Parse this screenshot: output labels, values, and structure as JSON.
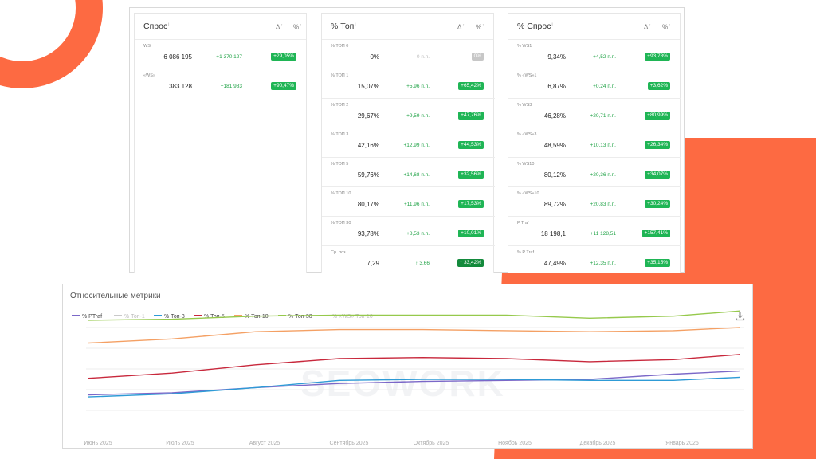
{
  "colors": {
    "accent_orange": "#fd6a42",
    "badge_green": "#1fb555",
    "delta_green": "#21a347",
    "badge_grey": "#c7c7c7"
  },
  "cards": [
    {
      "title": "Спрос",
      "col_delta": "Δ",
      "col_pct": "%",
      "rows": [
        {
          "label": "WS",
          "value": "6 086 195",
          "delta": "+1 370 127",
          "badge": "+29,05%"
        },
        {
          "label": "«WS»",
          "value": "383 128",
          "delta": "+181 983",
          "badge": "+90,47%"
        }
      ]
    },
    {
      "title": "% Топ",
      "col_delta": "Δ",
      "col_pct": "%",
      "rows": [
        {
          "label": "% ТОП 0",
          "value": "0%",
          "delta": "0 п.п.",
          "badge": "0%"
        },
        {
          "label": "% ТОП 1",
          "value": "15,07%",
          "delta": "+5,96 п.п.",
          "badge": "+65,42%"
        },
        {
          "label": "% ТОП 2",
          "value": "29,67%",
          "delta": "+9,59 п.п.",
          "badge": "+47,76%"
        },
        {
          "label": "% ТОП 3",
          "value": "42,16%",
          "delta": "+12,99 п.п.",
          "badge": "+44,53%"
        },
        {
          "label": "% ТОП 5",
          "value": "59,76%",
          "delta": "+14,68 п.п.",
          "badge": "+32,56%"
        },
        {
          "label": "% ТОП 10",
          "value": "80,17%",
          "delta": "+11,96 п.п.",
          "badge": "+17,53%"
        },
        {
          "label": "% ТОП 30",
          "value": "93,78%",
          "delta": "+8,53 п.п.",
          "badge": "+10,01%"
        },
        {
          "label": "Ср. поз.",
          "value": "7,29",
          "delta": "↑ 3,66",
          "badge": "↑ 33,42%"
        }
      ]
    },
    {
      "title": "% Спрос",
      "col_delta": "Δ",
      "col_pct": "%",
      "rows": [
        {
          "label": "% WS1",
          "value": "9,34%",
          "delta": "+4,52 п.п.",
          "badge": "+93,78%"
        },
        {
          "label": "% «WS»1",
          "value": "6,87%",
          "delta": "+0,24 п.п.",
          "badge": "+3,62%"
        },
        {
          "label": "% WS3",
          "value": "46,28%",
          "delta": "+20,71 п.п.",
          "badge": "+80,99%"
        },
        {
          "label": "% «WS»3",
          "value": "48,59%",
          "delta": "+10,13 п.п.",
          "badge": "+26,34%"
        },
        {
          "label": "% WS10",
          "value": "80,12%",
          "delta": "+20,36 п.п.",
          "badge": "+34,07%"
        },
        {
          "label": "% «WS»10",
          "value": "89,72%",
          "delta": "+20,83 п.п.",
          "badge": "+30,24%"
        },
        {
          "label": "P Traf",
          "value": "18 198,1",
          "delta": "+11 128,51",
          "badge": "+157,41%"
        },
        {
          "label": "% P Traf",
          "value": "47,49%",
          "delta": "+12,35 п.п.",
          "badge": "+35,15%"
        }
      ]
    }
  ],
  "chart": {
    "title": "Относительные метрики",
    "watermark": "SEOWORK",
    "download_icon": "download-icon"
  },
  "chart_data": {
    "type": "line",
    "title": "Относительные метрики",
    "categories": [
      "Июнь 2025",
      "Июль 2025",
      "Август 2025",
      "Сентябрь 2025",
      "Октябрь 2025",
      "Ноябрь 2025",
      "Декабрь 2025",
      "Январь 2026"
    ],
    "ylim": [
      0,
      100
    ],
    "grid": true,
    "legend": "top-left",
    "x": [
      0,
      1,
      2,
      3,
      4,
      5,
      6,
      7,
      7.8
    ],
    "series": [
      {
        "name": "% PTraf",
        "color": "#7b68c8",
        "active": true,
        "values": [
          15,
          17,
          22,
          26,
          28,
          29,
          30,
          35,
          38
        ]
      },
      {
        "name": "% Топ-1",
        "color": "#c9c9c9",
        "active": false,
        "values": []
      },
      {
        "name": "% Топ-3",
        "color": "#2e9bd6",
        "active": true,
        "values": [
          13,
          16,
          22,
          29,
          30,
          30,
          29,
          29,
          32
        ]
      },
      {
        "name": "% Топ-5",
        "color": "#c8283c",
        "active": true,
        "values": [
          31,
          36,
          44,
          50,
          51,
          50,
          47,
          49,
          54
        ]
      },
      {
        "name": "% Топ-10",
        "color": "#f4a064",
        "active": true,
        "values": [
          65,
          69,
          76,
          78,
          78,
          77,
          76,
          77,
          80
        ]
      },
      {
        "name": "% Топ-30",
        "color": "#96c94c",
        "active": true,
        "values": [
          87,
          88,
          91,
          92,
          92,
          92,
          89,
          91,
          96
        ]
      },
      {
        "name": "% «WS» Топ-10",
        "color": "#c9c9c9",
        "active": false,
        "values": []
      }
    ]
  }
}
